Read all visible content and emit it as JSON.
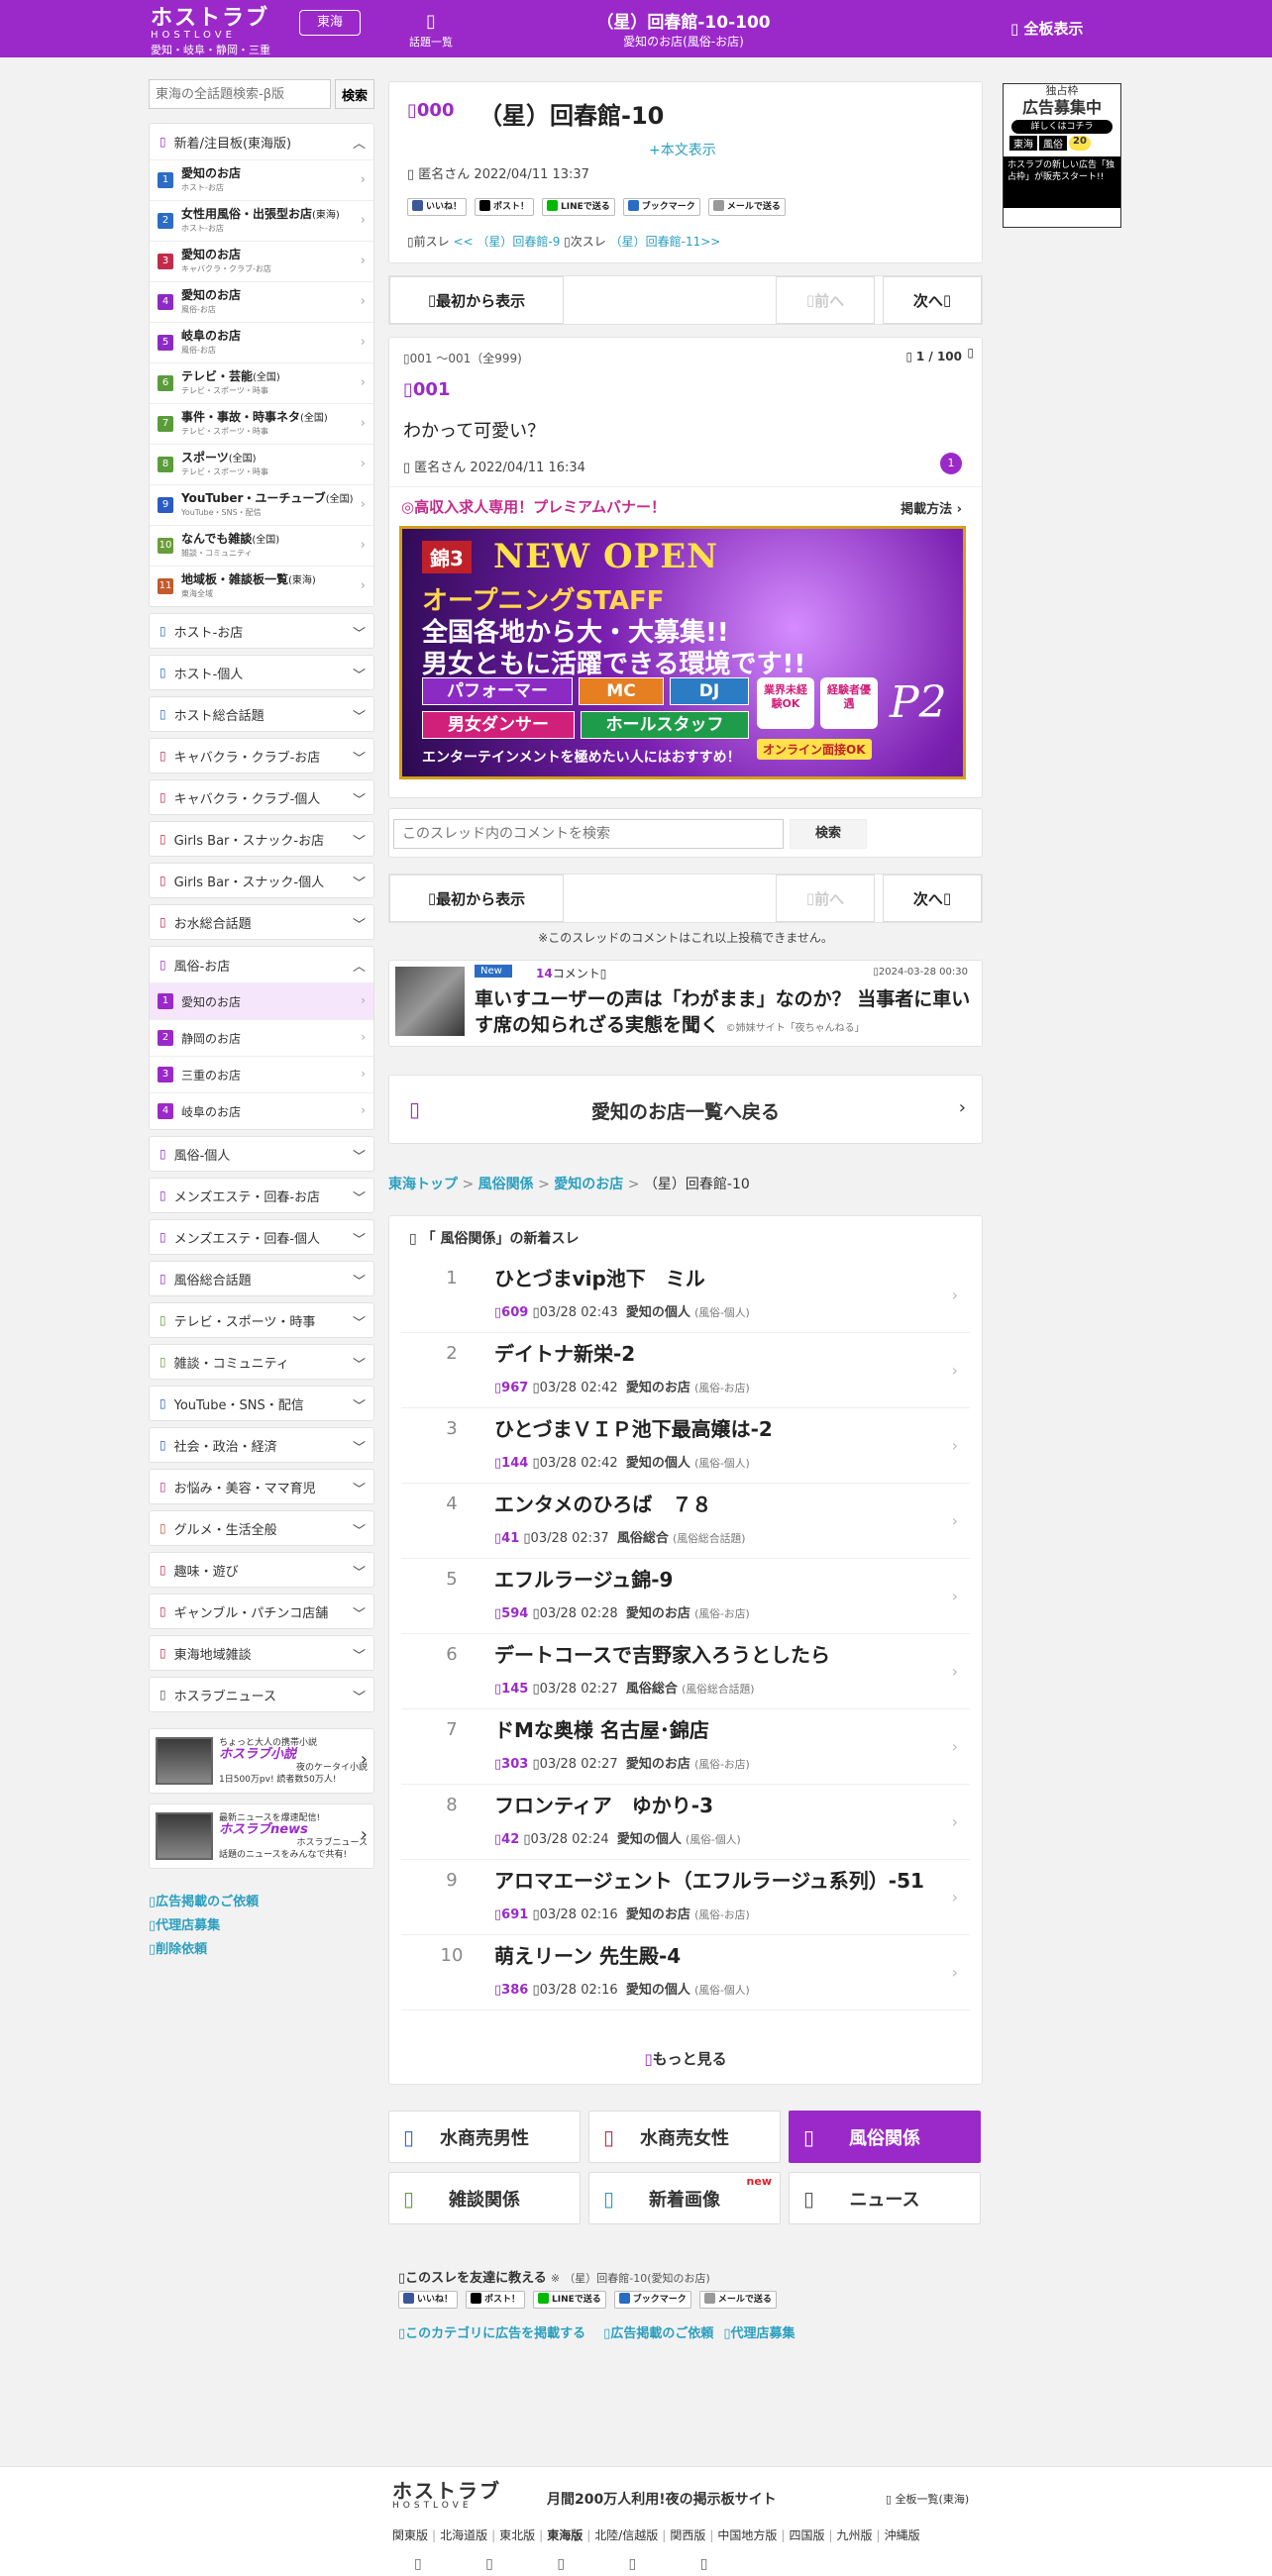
{
  "header": {
    "logo_main": "ホストラブ",
    "logo_sub": "HOSTLOVE",
    "logo_area": "愛知・岐阜・静岡・三重",
    "region_button": "東海",
    "topics_label": "話題一覧",
    "thread_title": "（星）回春館-10-100",
    "thread_sub": "愛知のお店(風俗-お店)",
    "all_boards": "全板表示"
  },
  "sidebar": {
    "search_placeholder": "東海の全話題検索-β版",
    "search_button": "検索",
    "new_section": "新着/注目板(東海版)",
    "new_items": [
      {
        "num": "1",
        "label": "愛知のお店",
        "extra": "",
        "sub": "ホスト-お店",
        "color": "#2b6cc4"
      },
      {
        "num": "2",
        "label": "女性用風俗・出張型お店",
        "extra": "(東海)",
        "sub": "ホスト-お店",
        "color": "#2b6cc4"
      },
      {
        "num": "3",
        "label": "愛知のお店",
        "extra": "",
        "sub": "キャバクラ・クラブ-お店",
        "color": "#c42b4b"
      },
      {
        "num": "4",
        "label": "愛知のお店",
        "extra": "",
        "sub": "風俗-お店",
        "color": "#8c2bc4"
      },
      {
        "num": "5",
        "label": "岐阜のお店",
        "extra": "",
        "sub": "風俗-お店",
        "color": "#8c2bc4"
      },
      {
        "num": "6",
        "label": "テレビ・芸能",
        "extra": "(全国)",
        "sub": "テレビ・スポーツ・時事",
        "color": "#5a9c3a"
      },
      {
        "num": "7",
        "label": "事件・事故・時事ネタ",
        "extra": "(全国)",
        "sub": "テレビ・スポーツ・時事",
        "color": "#5a9c3a"
      },
      {
        "num": "8",
        "label": "スポーツ",
        "extra": "(全国)",
        "sub": "テレビ・スポーツ・時事",
        "color": "#5a9c3a"
      },
      {
        "num": "9",
        "label": "YouTuber・ユーチューブ",
        "extra": "(全国)",
        "sub": "YouTube・SNS・配信",
        "color": "#2b5cc4"
      },
      {
        "num": "10",
        "label": "なんでも雑談",
        "extra": "(全国)",
        "sub": "雑談・コミュニティ",
        "color": "#6a9c3a"
      },
      {
        "num": "11",
        "label": "地域板・雑談板一覧",
        "extra": "(東海)",
        "sub": "東海全域",
        "color": "#c45a2b"
      }
    ],
    "cats_a": [
      {
        "label": "ホスト-お店",
        "color": "#2b6cc4"
      },
      {
        "label": "ホスト-個人",
        "color": "#2b6cc4"
      },
      {
        "label": "ホスト総合話題",
        "color": "#2b6cc4"
      },
      {
        "label": "キャバクラ・クラブ-お店",
        "color": "#c42b4b"
      },
      {
        "label": "キャバクラ・クラブ-個人",
        "color": "#c42b4b"
      },
      {
        "label": "Girls Bar・スナック-お店",
        "color": "#c42b4b"
      },
      {
        "label": "Girls Bar・スナック-個人",
        "color": "#c42b4b"
      },
      {
        "label": "お水総合話題",
        "color": "#c42b4b"
      }
    ],
    "fuzoku_head": "風俗-お店",
    "fuzoku_items": [
      {
        "num": "1",
        "label": "愛知のお店"
      },
      {
        "num": "2",
        "label": "静岡のお店"
      },
      {
        "num": "3",
        "label": "三重のお店"
      },
      {
        "num": "4",
        "label": "岐阜のお店"
      }
    ],
    "cats_b": [
      {
        "label": "風俗-個人",
        "color": "#8c2bc4"
      },
      {
        "label": "メンズエステ・回春-お店",
        "color": "#8c2bc4"
      },
      {
        "label": "メンズエステ・回春-個人",
        "color": "#8c2bc4"
      },
      {
        "label": "風俗総合話題",
        "color": "#8c2bc4"
      },
      {
        "label": "テレビ・スポーツ・時事",
        "color": "#5a9c3a"
      },
      {
        "label": "雑談・コミュニティ",
        "color": "#6a9c3a"
      },
      {
        "label": "YouTube・SNS・配信",
        "color": "#2b5cc4"
      },
      {
        "label": "社会・政治・経済",
        "color": "#2b5cc4"
      },
      {
        "label": "お悩み・美容・ママ育児",
        "color": "#c42b8c"
      },
      {
        "label": "グルメ・生活全般",
        "color": "#c45a2b"
      },
      {
        "label": "趣味・遊び",
        "color": "#c42b4b"
      },
      {
        "label": "ギャンブル・パチンコ店舗",
        "color": "#c42b4b"
      },
      {
        "label": "東海地域雑談",
        "color": "#c42b4b"
      },
      {
        "label": "ホスラブニュース",
        "color": "#555555"
      }
    ],
    "promo1": {
      "top": "ちょっと大人の携帯小説",
      "brand": "ホスラブ小説",
      "line1": "夜のケータイ小説",
      "line2": "1日500万pv! 読者数50万人!"
    },
    "promo2": {
      "top": "最新ニュースを爆速配信!",
      "brand": "ホスラブnews",
      "line1": "ホスラブニュース",
      "line2": "話題のニュースをみんなで共有!"
    },
    "links": [
      "広告掲載のご依頼",
      "代理店募集",
      "削除依頼"
    ]
  },
  "thread": {
    "num": "000",
    "title": "（星）回春館-10",
    "show_body": "+本文表示",
    "author_date": "匿名さん 2022/04/11 13:37",
    "share": [
      "いいね！",
      "ポスト！",
      "LINEで送る",
      "ブックマーク",
      "メールで送る"
    ],
    "prev_label": "前スレ",
    "prev_link": "<< （星）回春館-9",
    "next_label": "次スレ",
    "next_link": "（星）回春館-11>>"
  },
  "nav": {
    "first": "最初から表示",
    "prev": "前へ",
    "next": "次へ"
  },
  "post": {
    "range": "001 〜001（全999)",
    "page": "1 / 100",
    "num": "001",
    "body": "わかって可愛い？",
    "author_date": "匿名さん 2022/04/11 16:34",
    "badge": "1"
  },
  "premium": {
    "label": "◎高収入求人専用！プレミアムバナー！",
    "method": "掲載方法",
    "banner_tag": "錦3",
    "banner_head": "NEW OPEN",
    "banner_l1": "オープニングSTAFF",
    "banner_l2": "全国各地から大・大募集!!",
    "banner_l3": "男女ともに活躍できる環境です!!",
    "roles": [
      "パフォーマー",
      "MC",
      "DJ",
      "男女ダンサー",
      "ホールスタッフ"
    ],
    "badges": [
      "業界未経験OK",
      "経験者優遇"
    ],
    "footer": "エンターテインメントを極めたい人にはおすすめ！",
    "online": "オンライン面接OK",
    "logo": "P2"
  },
  "search": {
    "placeholder": "このスレッド内のコメントを検索",
    "button": "検索"
  },
  "notice": "※このスレッドのコメントはこれ以上投稿できません。",
  "news": {
    "badge": "New",
    "count": "14",
    "count_suffix": "コメント",
    "date": "2024-03-28 00:30",
    "title": "車いすユーザーの声は「わがまま」なのか？ 当事者に車いす席の知られざる実態を聞く",
    "source": "©姉妹サイト「夜ちゃんねる」"
  },
  "back_link": "愛知のお店一覧へ戻る",
  "breadcrumb": [
    "東海トップ",
    "風俗関係",
    "愛知のお店",
    "（星）回春館-10"
  ],
  "new_threads": {
    "header": "「 風俗関係」の新着スレ",
    "items": [
      {
        "rank": "1",
        "title": "ひとづまvip池下　ミル",
        "count": "609",
        "date": "03/28 02:43",
        "board": "愛知の個人",
        "cat": "(風俗-個人)"
      },
      {
        "rank": "2",
        "title": "デイトナ新栄-2",
        "count": "967",
        "date": "03/28 02:42",
        "board": "愛知のお店",
        "cat": "(風俗-お店)"
      },
      {
        "rank": "3",
        "title": "ひとづまＶＩＰ池下最高嬢は-2",
        "count": "144",
        "date": "03/28 02:42",
        "board": "愛知の個人",
        "cat": "(風俗-個人)"
      },
      {
        "rank": "4",
        "title": "エンタメのひろば　７８",
        "count": "41",
        "date": "03/28 02:37",
        "board": "風俗総合",
        "cat": "(風俗総合話題)"
      },
      {
        "rank": "5",
        "title": "エフルラージュ錦-9",
        "count": "594",
        "date": "03/28 02:28",
        "board": "愛知のお店",
        "cat": "(風俗-お店)"
      },
      {
        "rank": "6",
        "title": "デートコースで吉野家入ろうとしたら",
        "count": "145",
        "date": "03/28 02:27",
        "board": "風俗総合",
        "cat": "(風俗総合話題)"
      },
      {
        "rank": "7",
        "title": "ドMな奥様 名古屋･錦店",
        "count": "303",
        "date": "03/28 02:27",
        "board": "愛知のお店",
        "cat": "(風俗-お店)"
      },
      {
        "rank": "8",
        "title": "フロンティア　ゆかり-3",
        "count": "42",
        "date": "03/28 02:24",
        "board": "愛知の個人",
        "cat": "(風俗-個人)"
      },
      {
        "rank": "9",
        "title": "アロマエージェント（エフルラージュ系列）-51",
        "count": "691",
        "date": "03/28 02:16",
        "board": "愛知のお店",
        "cat": "(風俗-お店)"
      },
      {
        "rank": "10",
        "title": "萌えリーン 先生殿-4",
        "count": "386",
        "date": "03/28 02:16",
        "board": "愛知の個人",
        "cat": "(風俗-個人)"
      }
    ],
    "more": "もっと見る"
  },
  "categories": [
    {
      "label": "水商売男性",
      "color": "#2b6cc4"
    },
    {
      "label": "水商売女性",
      "color": "#c42b4b"
    },
    {
      "label": "風俗関係",
      "color": "#ffffff"
    },
    {
      "label": "雑談関係",
      "color": "#6a9c3a"
    },
    {
      "label": "新着画像",
      "color": "#2b9cc4",
      "new": "new"
    },
    {
      "label": "ニュース",
      "color": "#555555"
    }
  ],
  "tell": {
    "label": "このスレを友達に教える",
    "mark": "※",
    "thread": "（星）回春館-10(愛知のお店)",
    "links": [
      "このカテゴリに広告を掲載する",
      "広告掲載のご依頼",
      "代理店募集"
    ]
  },
  "right_ad": {
    "top": "独占枠",
    "head": "広告募集中",
    "btn": "詳しくはコチラ",
    "tags": [
      "東海",
      "風俗"
    ],
    "price": "20",
    "caption": "ホスラブの新しい広告「独占枠」が販売スタート!!"
  },
  "footer": {
    "logo": "ホストラブ",
    "logo_sub": "HOSTLOVE",
    "tagline": "月間200万人利用!夜の掲示板サイト",
    "all_boards": "全板一覧(東海)",
    "regions": [
      "関東版",
      "北海道版",
      "東北版",
      "東海版",
      "北陸/信越版",
      "関西版",
      "中国地方版",
      "四国版",
      "九州版",
      "沖縄版"
    ]
  },
  "colors": {
    "accent": "#9b29c9",
    "link": "#2a9fc0"
  }
}
